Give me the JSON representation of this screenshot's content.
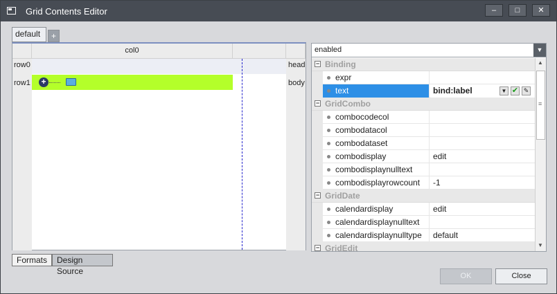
{
  "window": {
    "title": "Grid Contents Editor",
    "min_label": "–",
    "max_label": "□",
    "close_label": "✕"
  },
  "tabs": {
    "default_label": "default",
    "add_label": "+"
  },
  "grid": {
    "column_header": "col0",
    "rows": [
      {
        "label": "row0",
        "band": "head"
      },
      {
        "label": "row1",
        "band": "body"
      }
    ]
  },
  "properties": {
    "selector_value": "enabled",
    "categories": [
      {
        "name": "Binding",
        "items": [
          {
            "name": "expr",
            "value": ""
          },
          {
            "name": "text",
            "value": "bind:label",
            "selected": true
          }
        ]
      },
      {
        "name": "GridCombo",
        "items": [
          {
            "name": "combocodecol",
            "value": ""
          },
          {
            "name": "combodatacol",
            "value": ""
          },
          {
            "name": "combodataset",
            "value": ""
          },
          {
            "name": "combodisplay",
            "value": "edit"
          },
          {
            "name": "combodisplaynulltext",
            "value": ""
          },
          {
            "name": "combodisplayrowcount",
            "value": "-1"
          }
        ]
      },
      {
        "name": "GridDate",
        "items": [
          {
            "name": "calendardisplay",
            "value": "edit"
          },
          {
            "name": "calendardisplaynulltext",
            "value": ""
          },
          {
            "name": "calendardisplaynulltype",
            "value": "default"
          }
        ]
      },
      {
        "name": "GridEdit",
        "items": []
      }
    ]
  },
  "bottom_tabs": {
    "formats": "Formats",
    "design_source": "Design Source"
  },
  "buttons": {
    "ok": "OK",
    "close": "Close"
  },
  "colors": {
    "selected_row": "#b4ff2a",
    "prop_selected": "#2d8fe6",
    "titlebar": "#474c54"
  }
}
